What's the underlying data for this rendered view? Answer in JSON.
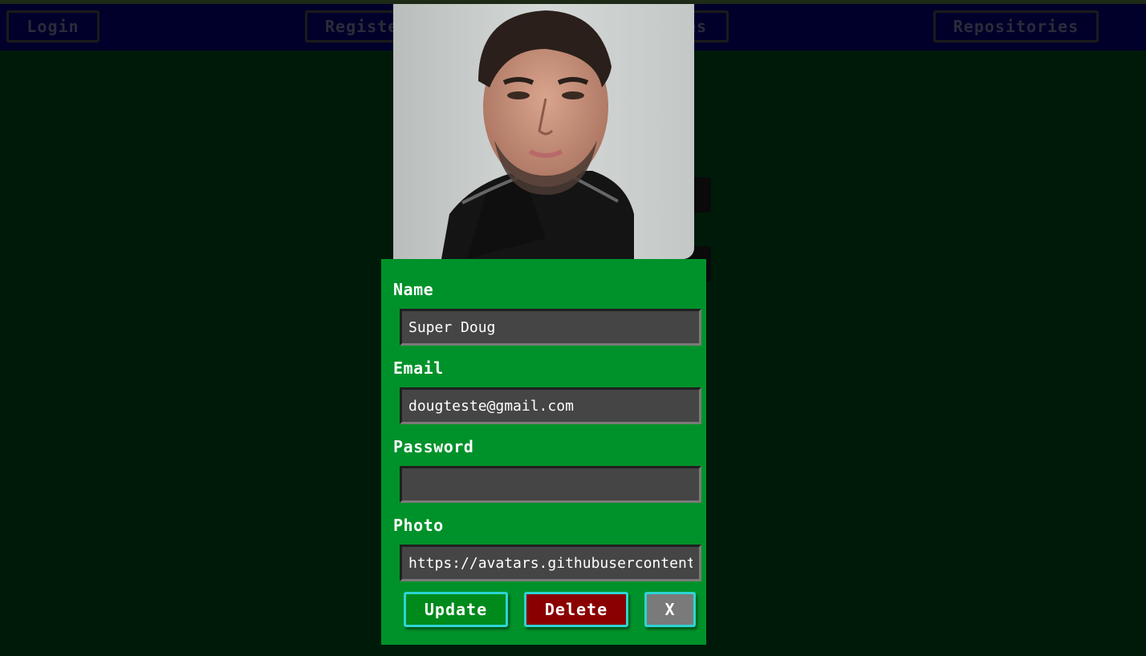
{
  "nav": {
    "login": "Login",
    "register": "Register",
    "middle": "es",
    "repositories": "Repositories"
  },
  "profile_form": {
    "name_label": "Name",
    "name_value": "Super Doug",
    "email_label": "Email",
    "email_value": "dougteste@gmail.com",
    "password_label": "Password",
    "password_value": "",
    "photo_label": "Photo",
    "photo_value": "https://avatars.githubusercontent.com",
    "update_label": "Update",
    "delete_label": "Delete",
    "close_label": "X"
  },
  "colors": {
    "modal_bg": "#00922a",
    "nav_bg": "#00002a",
    "update_bg": "#008a1c",
    "delete_bg": "#8a0000",
    "button_border": "#2cd4d4"
  }
}
